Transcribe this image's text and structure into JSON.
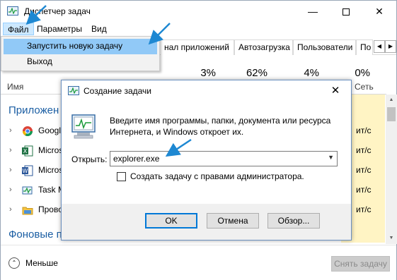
{
  "window": {
    "title": "Диспетчер задач",
    "controls": {
      "minimize": "—",
      "close": "✕"
    }
  },
  "menu": {
    "file": "Файл",
    "params": "Параметры",
    "view": "Вид"
  },
  "dropdown": {
    "run_new_task": "Запустить новую задачу",
    "exit": "Выход"
  },
  "tabs": {
    "apps_log": "нал приложений",
    "startup": "Автозагрузка",
    "users": "Пользователи",
    "more": "По"
  },
  "columns": {
    "name": "Имя",
    "net": "Сеть",
    "cpu_pct": "3%",
    "mem_pct": "62%",
    "disk_pct": "4%",
    "net_pct": "0%"
  },
  "groups": {
    "apps": "Приложен",
    "background": "Фоновые п"
  },
  "rows": [
    {
      "label": "Google",
      "net": "ит/с",
      "icon": "chrome-icon"
    },
    {
      "label": "Micros",
      "net": "ит/с",
      "icon": "excel-icon"
    },
    {
      "label": "Micros",
      "net": "ит/с",
      "icon": "word-icon"
    },
    {
      "label": "Task M",
      "net": "ит/с",
      "icon": "task-manager-icon"
    },
    {
      "label": "Прово",
      "net": "ит/с",
      "icon": "folder-icon"
    }
  ],
  "bottom": {
    "less": "Меньше",
    "end_task": "Снять задачу"
  },
  "dialog": {
    "title": "Создание задачи",
    "description": "Введите имя программы, папки, документа или ресурса Интернета, и Windows откроет их.",
    "open_label": "Открыть:",
    "command_value": "explorer.exe",
    "admin_checkbox_label": "Создать задачу с правами администратора.",
    "admin_checked": false,
    "ok": "OK",
    "cancel": "Отмена",
    "browse": "Обзор..."
  },
  "colors": {
    "accent_arrow": "#1e88d2",
    "menu_highlight": "#91c9f7",
    "group_title": "#1b5ea3",
    "column_highlight": "#fff4c4"
  }
}
